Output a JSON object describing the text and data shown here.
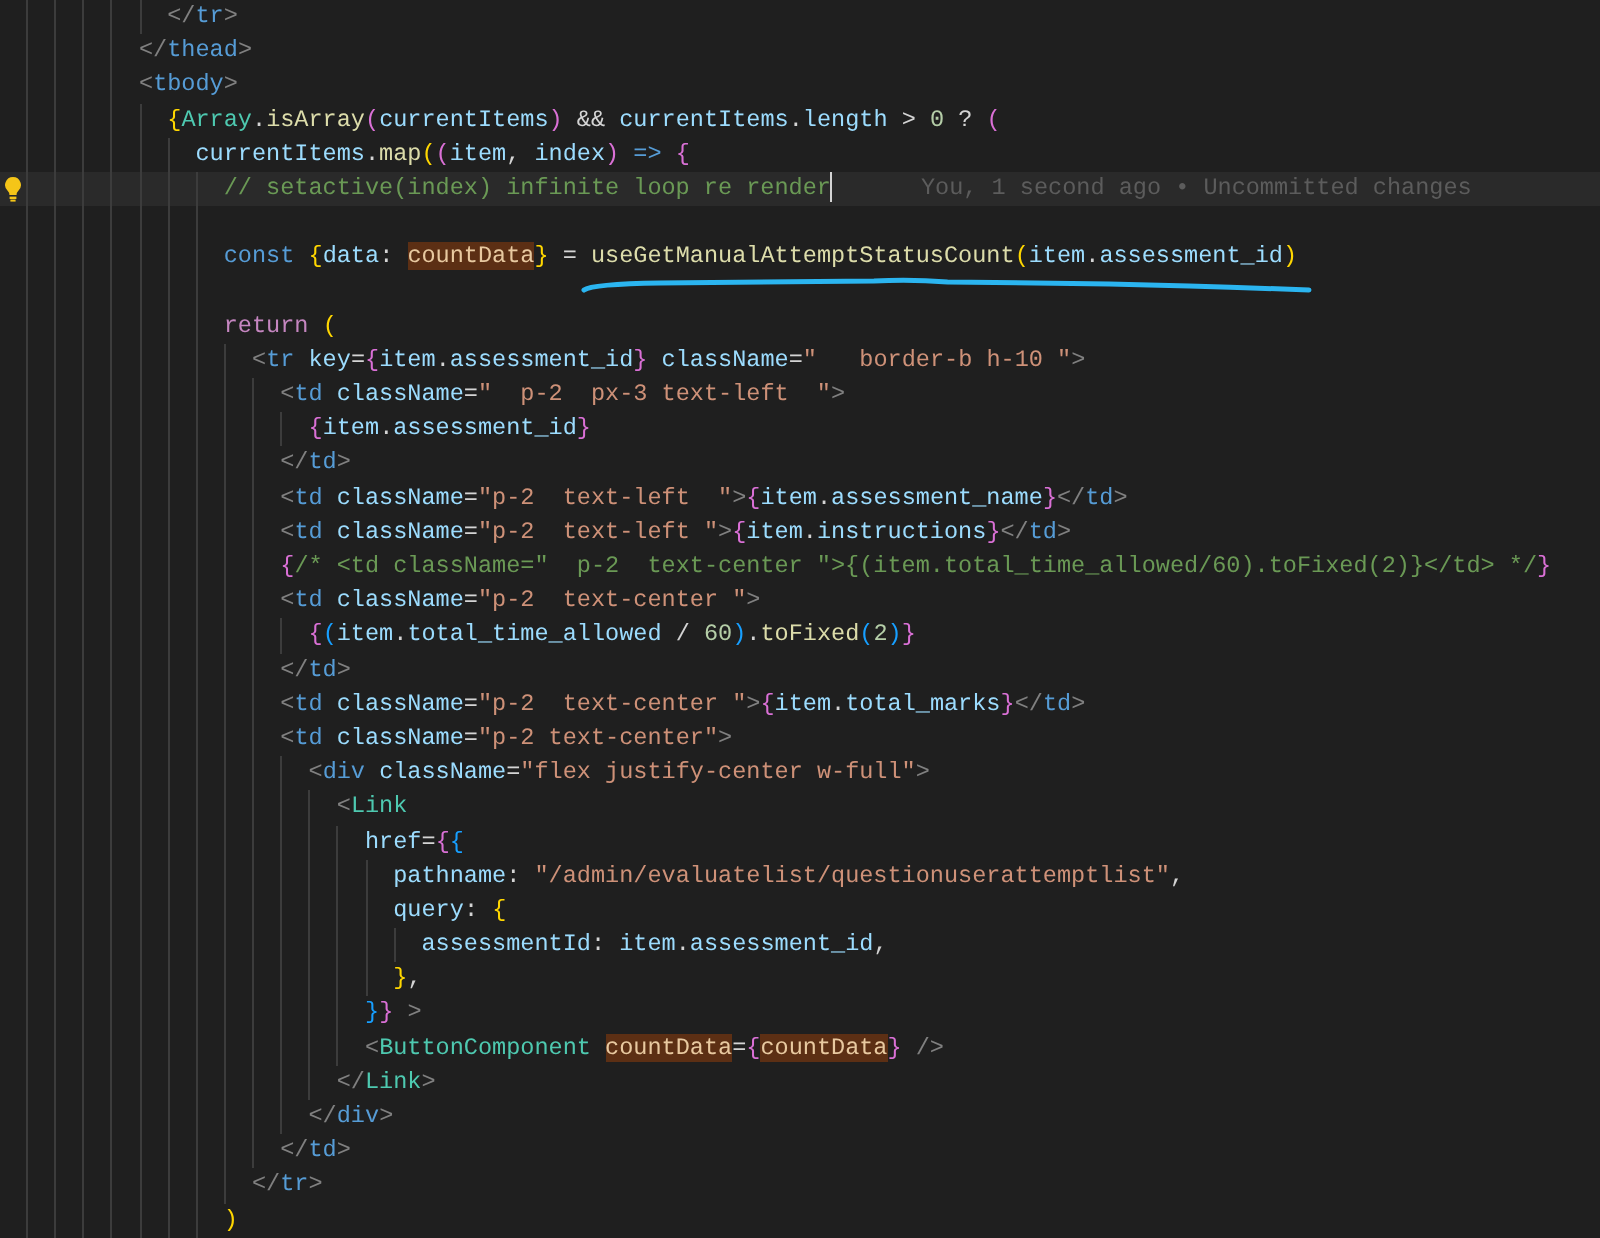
{
  "editor": {
    "lines": [
      {
        "kind": "code",
        "current": false,
        "tokens": [
          {
            "kind": "punc",
            "text": "          </"
          },
          {
            "kind": "tag",
            "text": "tr"
          },
          {
            "kind": "punc",
            "text": ">"
          }
        ]
      },
      {
        "kind": "code",
        "current": false,
        "tokens": [
          {
            "kind": "punc",
            "text": "        </"
          },
          {
            "kind": "tag",
            "text": "thead"
          },
          {
            "kind": "punc",
            "text": ">"
          }
        ]
      },
      {
        "kind": "code",
        "current": false,
        "tokens": [
          {
            "kind": "punc",
            "text": "        <"
          },
          {
            "kind": "tag",
            "text": "tbody"
          },
          {
            "kind": "punc",
            "text": ">"
          }
        ]
      },
      {
        "kind": "code",
        "current": false,
        "tokens": [
          {
            "kind": "b1",
            "text": "          {"
          },
          {
            "kind": "comp",
            "text": "Array"
          },
          {
            "kind": "p",
            "text": "."
          },
          {
            "kind": "fn",
            "text": "isArray"
          },
          {
            "kind": "b2",
            "text": "("
          },
          {
            "kind": "var",
            "text": "currentItems"
          },
          {
            "kind": "b2",
            "text": ")"
          },
          {
            "kind": "p",
            "text": " && "
          },
          {
            "kind": "var",
            "text": "currentItems"
          },
          {
            "kind": "p",
            "text": "."
          },
          {
            "kind": "var",
            "text": "length"
          },
          {
            "kind": "p",
            "text": " > "
          },
          {
            "kind": "num",
            "text": "0"
          },
          {
            "kind": "p",
            "text": " ? "
          },
          {
            "kind": "b2",
            "text": "("
          }
        ]
      },
      {
        "kind": "code",
        "current": false,
        "tokens": [
          {
            "kind": "var",
            "text": "            currentItems"
          },
          {
            "kind": "p",
            "text": "."
          },
          {
            "kind": "fn",
            "text": "map"
          },
          {
            "kind": "b1",
            "text": "("
          },
          {
            "kind": "b2",
            "text": "("
          },
          {
            "kind": "var",
            "text": "item"
          },
          {
            "kind": "p",
            "text": ", "
          },
          {
            "kind": "var",
            "text": "index"
          },
          {
            "kind": "b2",
            "text": ") "
          },
          {
            "kind": "kw",
            "text": "=> "
          },
          {
            "kind": "b2",
            "text": "{"
          }
        ]
      },
      {
        "kind": "code",
        "current": true,
        "lightbulb": true,
        "blame": "You, 1 second ago • Uncommitted changes",
        "tokens": [
          {
            "kind": "cm",
            "text": "              // setactive(index) infinite loop re render"
          }
        ]
      },
      {
        "kind": "blank",
        "current": false
      },
      {
        "kind": "code",
        "current": false,
        "underlined": true,
        "tokens": [
          {
            "kind": "kw",
            "text": "              const "
          },
          {
            "kind": "b1",
            "text": "{"
          },
          {
            "kind": "var",
            "text": "data"
          },
          {
            "kind": "p",
            "text": ": "
          },
          {
            "kind": "hl",
            "text": "countData"
          },
          {
            "kind": "b1",
            "text": "}"
          },
          {
            "kind": "p",
            "text": " = "
          },
          {
            "kind": "fn",
            "text": "useGetManualAttemptStatusCount"
          },
          {
            "kind": "b1",
            "text": "("
          },
          {
            "kind": "var",
            "text": "item"
          },
          {
            "kind": "p",
            "text": "."
          },
          {
            "kind": "var",
            "text": "assessment_id"
          },
          {
            "kind": "b1",
            "text": ")"
          }
        ]
      },
      {
        "kind": "blank",
        "current": false
      },
      {
        "kind": "code",
        "current": false,
        "tokens": [
          {
            "kind": "ctl",
            "text": "              return "
          },
          {
            "kind": "b1",
            "text": "("
          }
        ]
      },
      {
        "kind": "code",
        "current": false,
        "tokens": [
          {
            "kind": "punc",
            "text": "                <"
          },
          {
            "kind": "tag",
            "text": "tr "
          },
          {
            "kind": "attr",
            "text": "key"
          },
          {
            "kind": "p",
            "text": "="
          },
          {
            "kind": "b2",
            "text": "{"
          },
          {
            "kind": "var",
            "text": "item"
          },
          {
            "kind": "p",
            "text": "."
          },
          {
            "kind": "var",
            "text": "assessment_id"
          },
          {
            "kind": "b2",
            "text": "} "
          },
          {
            "kind": "attr",
            "text": "className"
          },
          {
            "kind": "p",
            "text": "="
          },
          {
            "kind": "str",
            "text": "\"   border-b h-10 \""
          },
          {
            "kind": "punc",
            "text": ">"
          }
        ]
      },
      {
        "kind": "code",
        "current": false,
        "tokens": [
          {
            "kind": "punc",
            "text": "                  <"
          },
          {
            "kind": "tag",
            "text": "td "
          },
          {
            "kind": "attr",
            "text": "className"
          },
          {
            "kind": "p",
            "text": "="
          },
          {
            "kind": "str",
            "text": "\"  p-2  px-3 text-left  \""
          },
          {
            "kind": "punc",
            "text": ">"
          }
        ]
      },
      {
        "kind": "code",
        "current": false,
        "tokens": [
          {
            "kind": "b2",
            "text": "                    {"
          },
          {
            "kind": "var",
            "text": "item"
          },
          {
            "kind": "p",
            "text": "."
          },
          {
            "kind": "var",
            "text": "assessment_id"
          },
          {
            "kind": "b2",
            "text": "}"
          }
        ]
      },
      {
        "kind": "code",
        "current": false,
        "tokens": [
          {
            "kind": "punc",
            "text": "                  </"
          },
          {
            "kind": "tag",
            "text": "td"
          },
          {
            "kind": "punc",
            "text": ">"
          }
        ]
      },
      {
        "kind": "code",
        "current": false,
        "tokens": [
          {
            "kind": "punc",
            "text": "                  <"
          },
          {
            "kind": "tag",
            "text": "td "
          },
          {
            "kind": "attr",
            "text": "className"
          },
          {
            "kind": "p",
            "text": "="
          },
          {
            "kind": "str",
            "text": "\"p-2  text-left  \""
          },
          {
            "kind": "punc",
            "text": ">"
          },
          {
            "kind": "b2",
            "text": "{"
          },
          {
            "kind": "var",
            "text": "item"
          },
          {
            "kind": "p",
            "text": "."
          },
          {
            "kind": "var",
            "text": "assessment_name"
          },
          {
            "kind": "b2",
            "text": "}"
          },
          {
            "kind": "punc",
            "text": "</"
          },
          {
            "kind": "tag",
            "text": "td"
          },
          {
            "kind": "punc",
            "text": ">"
          }
        ]
      },
      {
        "kind": "code",
        "current": false,
        "tokens": [
          {
            "kind": "punc",
            "text": "                  <"
          },
          {
            "kind": "tag",
            "text": "td "
          },
          {
            "kind": "attr",
            "text": "className"
          },
          {
            "kind": "p",
            "text": "="
          },
          {
            "kind": "str",
            "text": "\"p-2  text-left \""
          },
          {
            "kind": "punc",
            "text": ">"
          },
          {
            "kind": "b2",
            "text": "{"
          },
          {
            "kind": "var",
            "text": "item"
          },
          {
            "kind": "p",
            "text": "."
          },
          {
            "kind": "var",
            "text": "instructions"
          },
          {
            "kind": "b2",
            "text": "}"
          },
          {
            "kind": "punc",
            "text": "</"
          },
          {
            "kind": "tag",
            "text": "td"
          },
          {
            "kind": "punc",
            "text": ">"
          }
        ]
      },
      {
        "kind": "code",
        "current": false,
        "tokens": [
          {
            "kind": "b2",
            "text": "                  {"
          },
          {
            "kind": "cm",
            "text": "/* <td className=\"  p-2  text-center \">{(item.total_time_allowed/60).toFixed(2)}</td> */"
          },
          {
            "kind": "b2",
            "text": "}"
          }
        ]
      },
      {
        "kind": "code",
        "current": false,
        "tokens": [
          {
            "kind": "punc",
            "text": "                  <"
          },
          {
            "kind": "tag",
            "text": "td "
          },
          {
            "kind": "attr",
            "text": "className"
          },
          {
            "kind": "p",
            "text": "="
          },
          {
            "kind": "str",
            "text": "\"p-2  text-center \""
          },
          {
            "kind": "punc",
            "text": ">"
          }
        ]
      },
      {
        "kind": "code",
        "current": false,
        "tokens": [
          {
            "kind": "b2",
            "text": "                    {"
          },
          {
            "kind": "b3",
            "text": "("
          },
          {
            "kind": "var",
            "text": "item"
          },
          {
            "kind": "p",
            "text": "."
          },
          {
            "kind": "var",
            "text": "total_time_allowed"
          },
          {
            "kind": "p",
            "text": " / "
          },
          {
            "kind": "num",
            "text": "60"
          },
          {
            "kind": "b3",
            "text": ")"
          },
          {
            "kind": "p",
            "text": "."
          },
          {
            "kind": "fn",
            "text": "toFixed"
          },
          {
            "kind": "b3",
            "text": "("
          },
          {
            "kind": "num",
            "text": "2"
          },
          {
            "kind": "b3",
            "text": ")"
          },
          {
            "kind": "b2",
            "text": "}"
          }
        ]
      },
      {
        "kind": "code",
        "current": false,
        "tokens": [
          {
            "kind": "punc",
            "text": "                  </"
          },
          {
            "kind": "tag",
            "text": "td"
          },
          {
            "kind": "punc",
            "text": ">"
          }
        ]
      },
      {
        "kind": "code",
        "current": false,
        "tokens": [
          {
            "kind": "punc",
            "text": "                  <"
          },
          {
            "kind": "tag",
            "text": "td "
          },
          {
            "kind": "attr",
            "text": "className"
          },
          {
            "kind": "p",
            "text": "="
          },
          {
            "kind": "str",
            "text": "\"p-2  text-center \""
          },
          {
            "kind": "punc",
            "text": ">"
          },
          {
            "kind": "b2",
            "text": "{"
          },
          {
            "kind": "var",
            "text": "item"
          },
          {
            "kind": "p",
            "text": "."
          },
          {
            "kind": "var",
            "text": "total_marks"
          },
          {
            "kind": "b2",
            "text": "}"
          },
          {
            "kind": "punc",
            "text": "</"
          },
          {
            "kind": "tag",
            "text": "td"
          },
          {
            "kind": "punc",
            "text": ">"
          }
        ]
      },
      {
        "kind": "code",
        "current": false,
        "tokens": [
          {
            "kind": "punc",
            "text": "                  <"
          },
          {
            "kind": "tag",
            "text": "td "
          },
          {
            "kind": "attr",
            "text": "className"
          },
          {
            "kind": "p",
            "text": "="
          },
          {
            "kind": "str",
            "text": "\"p-2 text-center\""
          },
          {
            "kind": "punc",
            "text": ">"
          }
        ]
      },
      {
        "kind": "code",
        "current": false,
        "tokens": [
          {
            "kind": "punc",
            "text": "                    <"
          },
          {
            "kind": "tag",
            "text": "div "
          },
          {
            "kind": "attr",
            "text": "className"
          },
          {
            "kind": "p",
            "text": "="
          },
          {
            "kind": "str",
            "text": "\"flex justify-center w-full\""
          },
          {
            "kind": "punc",
            "text": ">"
          }
        ]
      },
      {
        "kind": "code",
        "current": false,
        "tokens": [
          {
            "kind": "punc",
            "text": "                      <"
          },
          {
            "kind": "comp",
            "text": "Link"
          }
        ]
      },
      {
        "kind": "code",
        "current": false,
        "tokens": [
          {
            "kind": "attr",
            "text": "                        href"
          },
          {
            "kind": "p",
            "text": "="
          },
          {
            "kind": "b2",
            "text": "{"
          },
          {
            "kind": "b3",
            "text": "{"
          }
        ]
      },
      {
        "kind": "code",
        "current": false,
        "tokens": [
          {
            "kind": "var",
            "text": "                          pathname"
          },
          {
            "kind": "p",
            "text": ": "
          },
          {
            "kind": "str",
            "text": "\"/admin/evaluatelist/questionuserattemptlist\""
          },
          {
            "kind": "p",
            "text": ","
          }
        ]
      },
      {
        "kind": "code",
        "current": false,
        "tokens": [
          {
            "kind": "var",
            "text": "                          query"
          },
          {
            "kind": "p",
            "text": ": "
          },
          {
            "kind": "b1",
            "text": "{"
          }
        ]
      },
      {
        "kind": "code",
        "current": false,
        "tokens": [
          {
            "kind": "var",
            "text": "                            assessmentId"
          },
          {
            "kind": "p",
            "text": ": "
          },
          {
            "kind": "var",
            "text": "item"
          },
          {
            "kind": "p",
            "text": "."
          },
          {
            "kind": "var",
            "text": "assessment_id"
          },
          {
            "kind": "p",
            "text": ","
          }
        ]
      },
      {
        "kind": "code",
        "current": false,
        "tokens": [
          {
            "kind": "b1",
            "text": "                          }"
          },
          {
            "kind": "p",
            "text": ","
          }
        ]
      },
      {
        "kind": "code",
        "current": false,
        "tokens": [
          {
            "kind": "b3",
            "text": "                        }"
          },
          {
            "kind": "b2",
            "text": "} "
          },
          {
            "kind": "punc",
            "text": ">"
          }
        ]
      },
      {
        "kind": "code",
        "current": false,
        "tokens": [
          {
            "kind": "punc",
            "text": "                        <"
          },
          {
            "kind": "comp",
            "text": "ButtonComponent "
          },
          {
            "kind": "hl",
            "text": "countData"
          },
          {
            "kind": "p",
            "text": "="
          },
          {
            "kind": "b2",
            "text": "{"
          },
          {
            "kind": "hl",
            "text": "countData"
          },
          {
            "kind": "b2",
            "text": "} "
          },
          {
            "kind": "punc",
            "text": "/>"
          }
        ]
      },
      {
        "kind": "code",
        "current": false,
        "tokens": [
          {
            "kind": "punc",
            "text": "                      </"
          },
          {
            "kind": "comp",
            "text": "Link"
          },
          {
            "kind": "punc",
            "text": ">"
          }
        ]
      },
      {
        "kind": "code",
        "current": false,
        "tokens": [
          {
            "kind": "punc",
            "text": "                    </"
          },
          {
            "kind": "tag",
            "text": "div"
          },
          {
            "kind": "punc",
            "text": ">"
          }
        ]
      },
      {
        "kind": "code",
        "current": false,
        "tokens": [
          {
            "kind": "punc",
            "text": "                  </"
          },
          {
            "kind": "tag",
            "text": "td"
          },
          {
            "kind": "punc",
            "text": ">"
          }
        ]
      },
      {
        "kind": "code",
        "current": false,
        "tokens": [
          {
            "kind": "punc",
            "text": "                </"
          },
          {
            "kind": "tag",
            "text": "tr"
          },
          {
            "kind": "punc",
            "text": ">"
          }
        ]
      },
      {
        "kind": "code",
        "current": false,
        "tokens": [
          {
            "kind": "b1",
            "text": "              )"
          }
        ]
      }
    ]
  }
}
